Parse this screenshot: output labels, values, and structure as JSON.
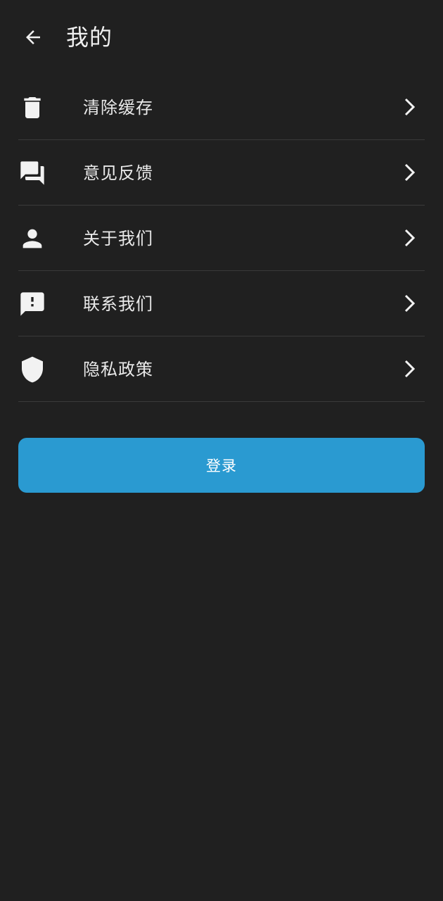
{
  "header": {
    "title": "我的",
    "back_icon": "arrow-left-icon"
  },
  "menu": {
    "items": [
      {
        "label": "清除缓存",
        "icon": "trash-icon"
      },
      {
        "label": "意见反馈",
        "icon": "forum-icon"
      },
      {
        "label": "关于我们",
        "icon": "person-icon"
      },
      {
        "label": "联系我们",
        "icon": "feedback-icon"
      },
      {
        "label": "隐私政策",
        "icon": "shield-icon"
      }
    ],
    "chevron_icon": "chevron-right-icon"
  },
  "login": {
    "label": "登录"
  },
  "colors": {
    "background": "#202020",
    "text": "#eaeaea",
    "divider": "#3a3a3a",
    "accent": "#2a9ad1"
  }
}
